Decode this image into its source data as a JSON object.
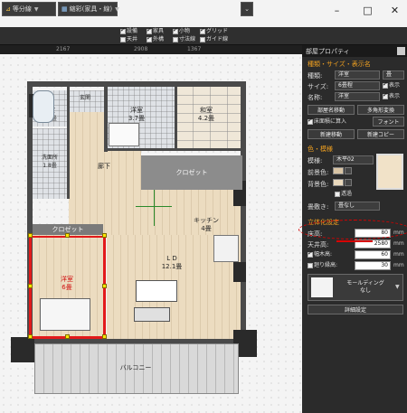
{
  "window": {
    "minimize": "–",
    "maximize": "□",
    "close": "✕"
  },
  "toolbar": {
    "wall_style": "等分線",
    "view_mode": "縮彩(家具・線)",
    "checkboxes": [
      {
        "label": "設備",
        "checked": true
      },
      {
        "label": "天井",
        "checked": false
      },
      {
        "label": "家具",
        "checked": true
      },
      {
        "label": "外構",
        "checked": true
      },
      {
        "label": "小物",
        "checked": true
      },
      {
        "label": "寸法線",
        "checked": false
      },
      {
        "label": "グリッド",
        "checked": true
      },
      {
        "label": "ガイド線",
        "checked": false
      }
    ]
  },
  "ruler": {
    "marks": [
      "2167",
      "2908",
      "1367"
    ]
  },
  "plan": {
    "rooms": [
      {
        "name": "洋室",
        "size": "3.7畳"
      },
      {
        "name": "和室",
        "size": "4.2畳"
      },
      {
        "name": "廊下",
        "size": ""
      },
      {
        "name": "キッチン",
        "size": "4畳"
      },
      {
        "name": "L D",
        "size": "12.1畳"
      },
      {
        "name": "洋室",
        "size": "6畳"
      },
      {
        "name": "浴室",
        "size": "1.2畳"
      },
      {
        "name": "洗面所",
        "size": "1.8畳"
      },
      {
        "name": "玄関",
        "size": ""
      }
    ],
    "closet_main": "クロゼット",
    "closet_small": "クロゼット",
    "balcony": "バルコニー"
  },
  "panel": {
    "title": "部屋プロパティ",
    "section_kind": "種類・サイズ・表示名",
    "kind_label": "種類:",
    "kind_value": "洋室",
    "kind_unit": "畳",
    "size_label": "サイズ:",
    "size_value": "6畳程",
    "show_label": "表示",
    "name_label": "名称:",
    "name_value": "洋室",
    "btn_room_move": "部屋名移動",
    "btn_shape": "多角形変換",
    "floor_cb": "床面積に算入",
    "btn_font": "フォント",
    "btn_create_move": "新建移動",
    "btn_create_copy": "新建コピー",
    "section_color": "色・模様",
    "pattern_label": "模様:",
    "pattern_value": "木平02",
    "fg_label": "前景色:",
    "bg_label": "背景色:",
    "transparent_label": "透過",
    "tatami_label": "畳敷き:",
    "tatami_value": "畳なし",
    "section_3d": "立体化設定",
    "floor_h_label": "床高:",
    "floor_h_value": "80",
    "ceil_h_label": "天井高:",
    "ceil_h_value": "2580",
    "baseboard_label": "幅木高:",
    "baseboard_value": "60",
    "molding_label": "廻り縁高:",
    "molding_value": "30",
    "mm": "mm",
    "molding_btn_line1": "モールディング",
    "molding_btn_line2": "なし",
    "detail_btn": "詳細設定"
  },
  "colors": {
    "selection": "#e21a1a",
    "panel_bg": "#2b2b2b",
    "section_head": "#f0a020"
  }
}
